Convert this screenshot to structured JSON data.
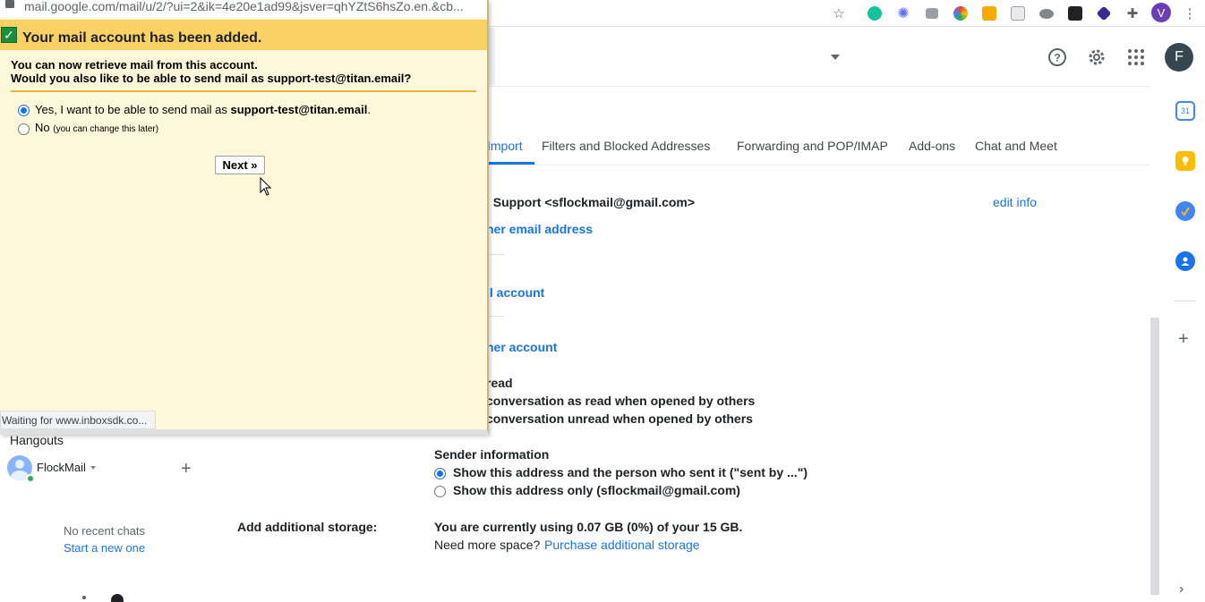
{
  "popup": {
    "url": "mail.google.com/mail/u/2/?ui=2&ik=4e20e1ad99&jsver=qhYZtS6hsZo.en.&cb...",
    "title": "Your mail account has been added.",
    "line1": "You can now retrieve mail from this account.",
    "line2": "Would you also like to be able to send mail as support-test@titan.email?",
    "option_yes_prefix": "Yes, I want to be able to send mail as ",
    "option_yes_email": "support-test@titan.email",
    "option_yes_suffix": ".",
    "option_no": "No",
    "option_no_note": "(you can change this later)",
    "next_label": "Next »",
    "status": "Waiting for www.inboxsdk.co..."
  },
  "header": {
    "avatar_letter": "F",
    "profile_letter": "V"
  },
  "tabs": [
    {
      "label": "Import",
      "active": true
    },
    {
      "label": "Filters and Blocked Addresses"
    },
    {
      "label": "Forwarding and POP/IMAP"
    },
    {
      "label": "Add-ons"
    },
    {
      "label": "Chat and Meet"
    }
  ],
  "settings": {
    "send_as_entry": "l Support <sflockmail@gmail.com>",
    "edit_info": "edit info",
    "add_email_link": "her email address",
    "check_mail_link": "il account",
    "add_account_link": "her account",
    "mark_read_title": "read",
    "mark_read_option1": "conversation as read when opened by others",
    "mark_read_option2": "conversation unread when opened by others",
    "sender_info_title": "Sender information",
    "sender_info_option1": "Show this address and the person who sent it (\"sent by ...\")",
    "sender_info_option2": "Show this address only (sflockmail@gmail.com)",
    "storage_label": "Add additional storage:",
    "storage_usage": "You are currently using 0.07 GB (0%) of your 15 GB.",
    "storage_more": "Need more space?",
    "storage_link": "Purchase additional storage"
  },
  "hangouts": {
    "title": "Hangouts",
    "user": "FlockMail",
    "no_chats": "No recent chats",
    "start_new": "Start a new one"
  },
  "colors": {
    "accent": "#1a73e8",
    "popup_header": "#fad165",
    "popup_bg": "#fff7da"
  }
}
